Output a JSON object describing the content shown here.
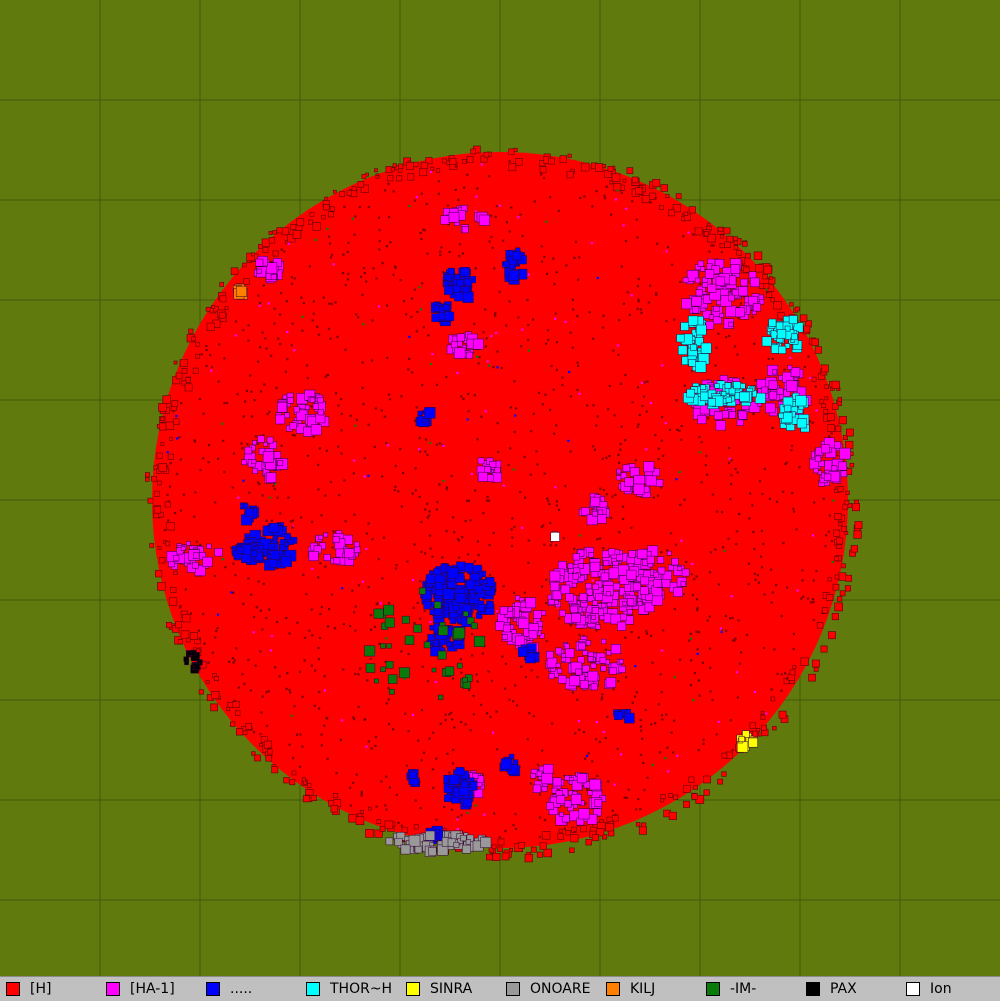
{
  "map": {
    "background_color": "#617a0d",
    "grid_color": "#3f5a0a",
    "planet_base_color": "#ff0000",
    "outline_color": "#5a0000"
  },
  "legend": [
    {
      "label": "[H]",
      "color": "#ff0000"
    },
    {
      "label": "[HA-1]",
      "color": "#ff00ff"
    },
    {
      "label": ".....",
      "color": "#0000ff"
    },
    {
      "label": "THOR~H",
      "color": "#00ffff"
    },
    {
      "label": "SINRA",
      "color": "#ffff00"
    },
    {
      "label": "ONOARE",
      "color": "#999999"
    },
    {
      "label": "KILJ",
      "color": "#ff8000"
    },
    {
      "label": "-IM-",
      "color": "#0a7a0a"
    },
    {
      "label": "PAX",
      "color": "#000000"
    },
    {
      "label": "Ion",
      "color": "#ffffff"
    }
  ]
}
